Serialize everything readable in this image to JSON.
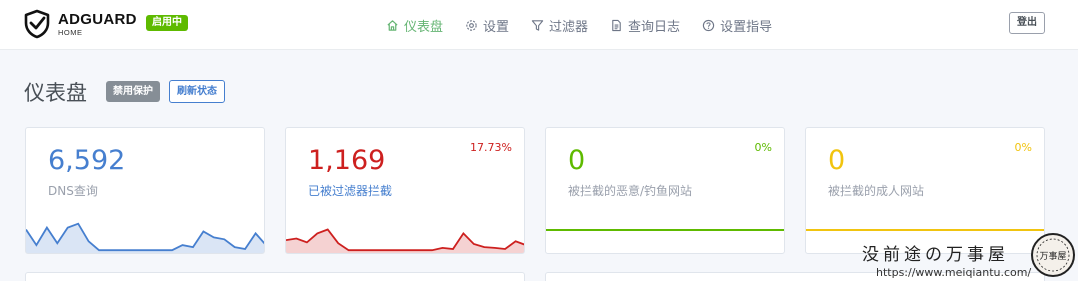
{
  "header": {
    "brand": "ADGUARD",
    "brand_sub": "HOME",
    "status": "启用中",
    "logout": "登出",
    "nav": [
      {
        "label": "仪表盘",
        "icon": "home-icon",
        "active": true
      },
      {
        "label": "设置",
        "icon": "gear-icon",
        "active": false
      },
      {
        "label": "过滤器",
        "icon": "filter-icon",
        "active": false
      },
      {
        "label": "查询日志",
        "icon": "document-icon",
        "active": false
      },
      {
        "label": "设置指导",
        "icon": "help-circle-icon",
        "active": false
      }
    ]
  },
  "page": {
    "title": "仪表盘",
    "disable_button": "禁用保护",
    "refresh_button": "刷新状态"
  },
  "cards": [
    {
      "value": "6,592",
      "label": "DNS查询",
      "percent": "",
      "color": "#467fcf",
      "series": [
        0.55,
        0.15,
        0.6,
        0.2,
        0.6,
        0.7,
        0.25,
        0.02,
        0.02,
        0.02,
        0.02,
        0.02,
        0.02,
        0.02,
        0.02,
        0.15,
        0.1,
        0.5,
        0.35,
        0.3,
        0.1,
        0.05,
        0.45,
        0.15
      ]
    },
    {
      "value": "1,169",
      "label": "已被过滤器拦截",
      "percent": "17.73%",
      "color": "#cd201f",
      "series": [
        0.28,
        0.32,
        0.22,
        0.45,
        0.55,
        0.2,
        0.02,
        0.02,
        0.02,
        0.02,
        0.02,
        0.02,
        0.02,
        0.02,
        0.02,
        0.08,
        0.05,
        0.45,
        0.18,
        0.1,
        0.08,
        0.05,
        0.25,
        0.15
      ]
    },
    {
      "value": "0",
      "label": "被拦截的恶意/钓鱼网站",
      "percent": "0%",
      "color": "#5eba00",
      "series": []
    },
    {
      "value": "0",
      "label": "被拦截的成人网站",
      "percent": "0%",
      "color": "#f1c40f",
      "series": []
    }
  ],
  "watermark": {
    "title": "没前途の万事屋",
    "url": "https://www.meiqiantu.com/",
    "seal": "万事屋"
  }
}
